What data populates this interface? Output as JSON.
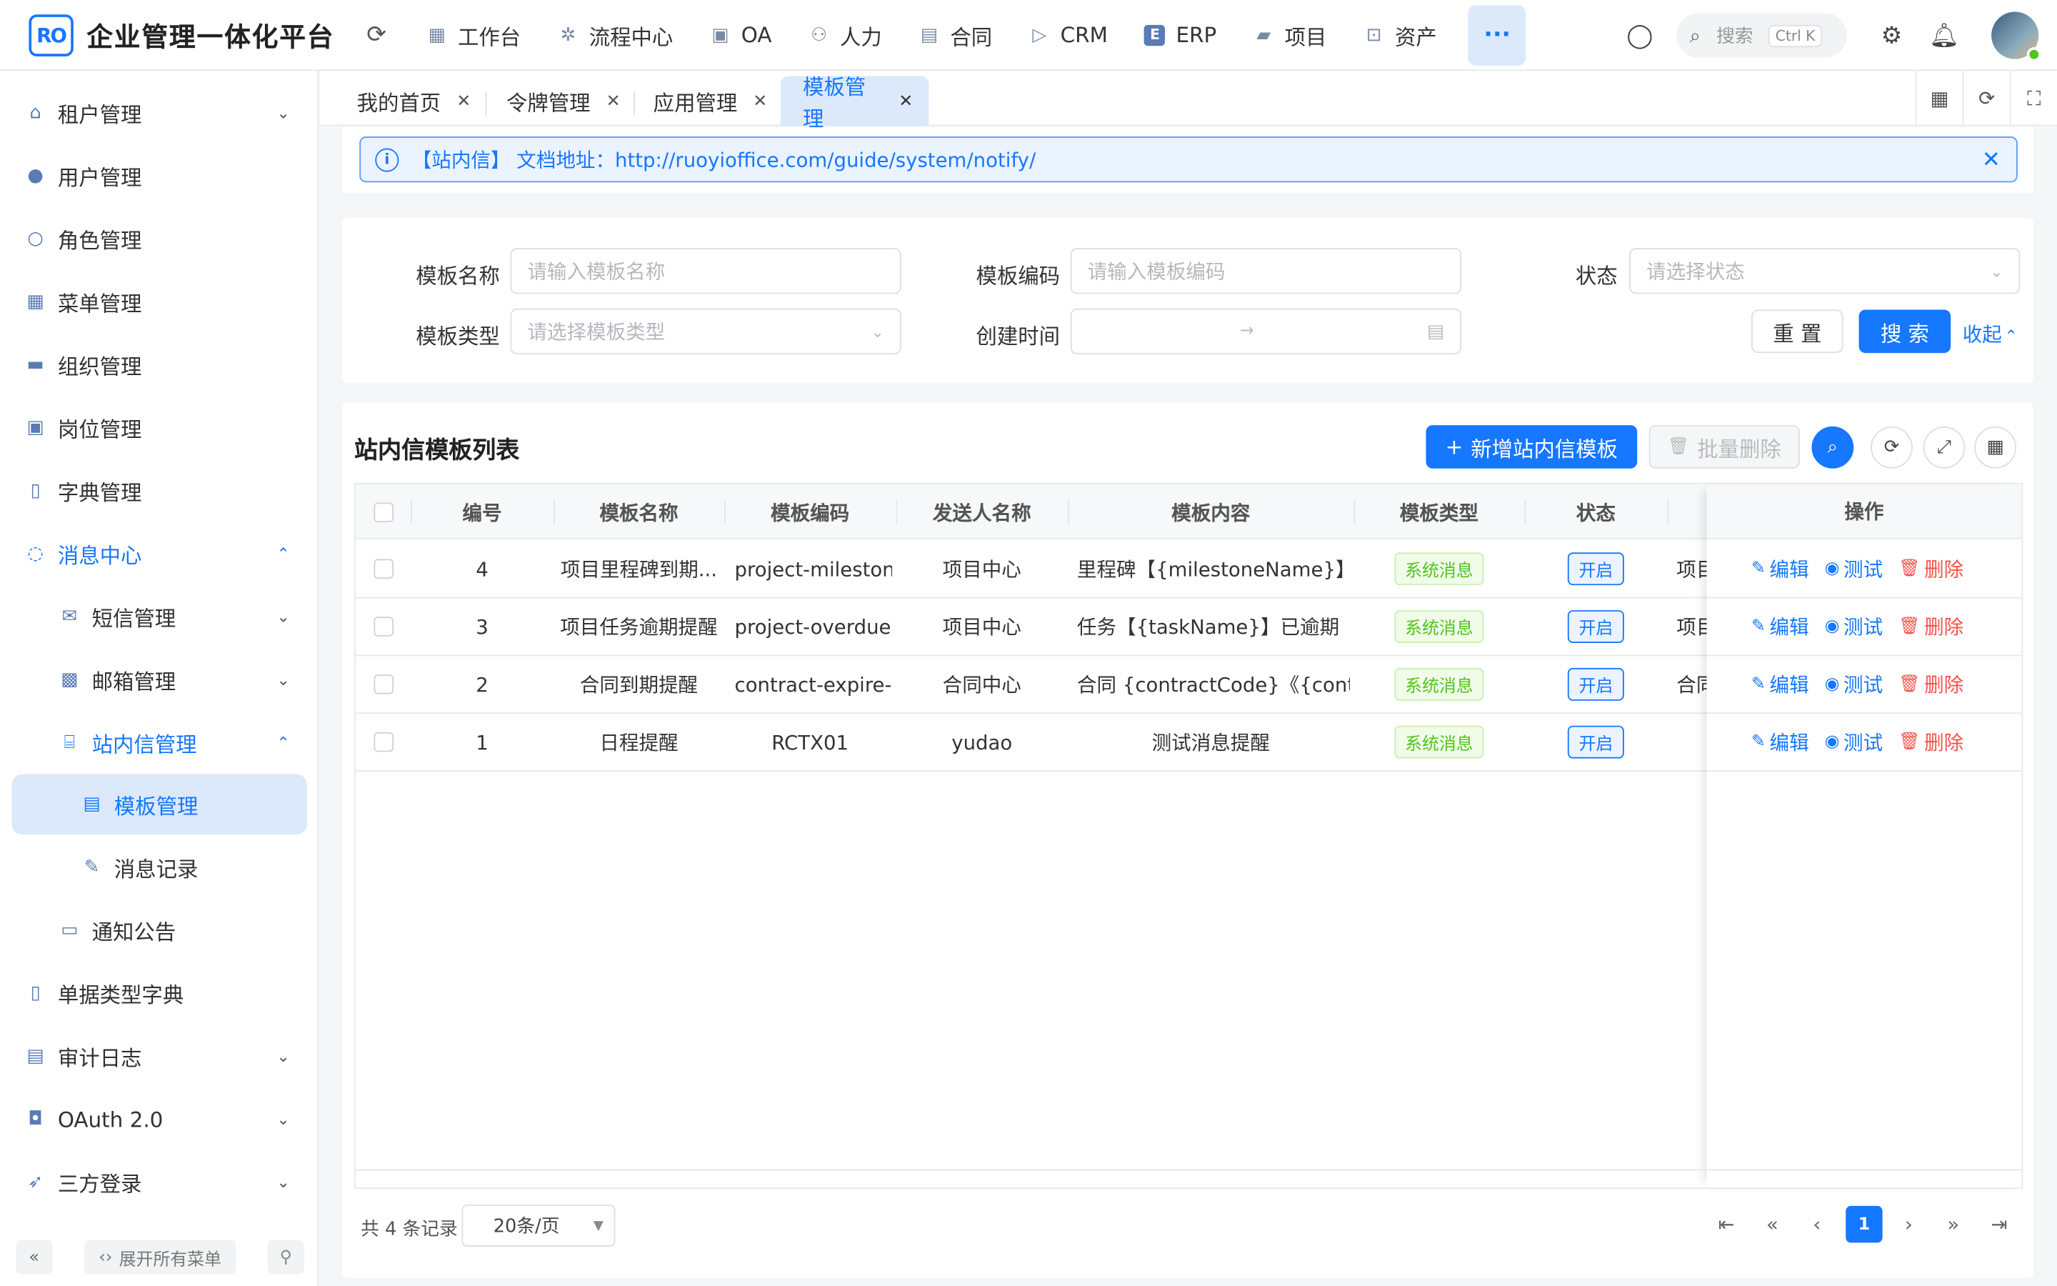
{
  "header": {
    "logo_mark": "RO",
    "title": "企业管理一体化平台",
    "nav": [
      {
        "label": "工作台",
        "icon": "grid-icon"
      },
      {
        "label": "流程中心",
        "icon": "atom-icon"
      },
      {
        "label": "OA",
        "icon": "monitor-icon"
      },
      {
        "label": "人力",
        "icon": "users-icon"
      },
      {
        "label": "合同",
        "icon": "document-icon"
      },
      {
        "label": "CRM",
        "icon": "send-icon"
      },
      {
        "label": "ERP",
        "icon": "erp-icon"
      },
      {
        "label": "项目",
        "icon": "briefcase-icon"
      },
      {
        "label": "资产",
        "icon": "box-icon"
      }
    ],
    "more": "···",
    "search_placeholder": "搜索",
    "search_shortcut": "Ctrl K"
  },
  "sidebar": {
    "items": [
      {
        "label": "租户管理",
        "icon": "home-icon",
        "chevron": "down"
      },
      {
        "label": "用户管理",
        "icon": "user-icon"
      },
      {
        "label": "角色管理",
        "icon": "role-icon"
      },
      {
        "label": "菜单管理",
        "icon": "menu-icon"
      },
      {
        "label": "组织管理",
        "icon": "org-icon"
      },
      {
        "label": "岗位管理",
        "icon": "post-icon"
      },
      {
        "label": "字典管理",
        "icon": "book-icon"
      },
      {
        "label": "消息中心",
        "icon": "chat-icon",
        "chevron": "up"
      },
      {
        "label": "短信管理",
        "icon": "mail-icon",
        "chevron": "down"
      },
      {
        "label": "邮箱管理",
        "icon": "mailbox-icon",
        "chevron": "down"
      },
      {
        "label": "站内信管理",
        "icon": "inbox-icon",
        "chevron": "up"
      },
      {
        "label": "模板管理",
        "icon": "archive-icon"
      },
      {
        "label": "消息记录",
        "icon": "edit-icon"
      },
      {
        "label": "通知公告",
        "icon": "notice-icon"
      },
      {
        "label": "单据类型字典",
        "icon": "file-icon"
      },
      {
        "label": "审计日志",
        "icon": "log-icon",
        "chevron": "down"
      },
      {
        "label": "OAuth 2.0",
        "icon": "oauth-icon",
        "chevron": "down"
      },
      {
        "label": "三方登录",
        "icon": "rocket-icon",
        "chevron": "down"
      }
    ],
    "expand_all": "展开所有菜单"
  },
  "tabs": [
    {
      "label": "我的首页"
    },
    {
      "label": "令牌管理"
    },
    {
      "label": "应用管理"
    },
    {
      "label": "模板管理"
    }
  ],
  "alert": {
    "text": "【站内信】 文档地址：http://ruoyioffice.com/guide/system/notify/"
  },
  "form": {
    "name_label": "模板名称",
    "name_placeholder": "请输入模板名称",
    "code_label": "模板编码",
    "code_placeholder": "请输入模板编码",
    "status_label": "状态",
    "status_placeholder": "请选择状态",
    "type_label": "模板类型",
    "type_placeholder": "请选择模板类型",
    "created_label": "创建时间",
    "range_sep": "→",
    "reset": "重 置",
    "search": "搜 索",
    "collapse": "收起"
  },
  "table": {
    "title": "站内信模板列表",
    "add_button": "新增站内信模板",
    "batch_delete": "批量删除",
    "columns": [
      "编号",
      "模板名称",
      "模板编码",
      "发送人名称",
      "模板内容",
      "模板类型",
      "状态",
      "操作"
    ],
    "rows": [
      {
        "id": "4",
        "name": "项目里程碑到期...",
        "code": "project-mileston...",
        "sender": "项目中心",
        "content": "里程碑【{milestoneName}】将...",
        "type": "系统消息",
        "status": "开启",
        "extra": "项目"
      },
      {
        "id": "3",
        "name": "项目任务逾期提醒",
        "code": "project-overdue...",
        "sender": "项目中心",
        "content": "任务【{taskName}】已逾期（...",
        "type": "系统消息",
        "status": "开启",
        "extra": "项目"
      },
      {
        "id": "2",
        "name": "合同到期提醒",
        "code": "contract-expire-...",
        "sender": "合同中心",
        "content": "合同 {contractCode}《{contrac...",
        "type": "系统消息",
        "status": "开启",
        "extra": "合同"
      },
      {
        "id": "1",
        "name": "日程提醒",
        "code": "RCTX01",
        "sender": "yudao",
        "content": "测试消息提醒",
        "type": "系统消息",
        "status": "开启",
        "extra": ""
      }
    ],
    "ops": {
      "edit": "编辑",
      "test": "测试",
      "delete": "删除"
    }
  },
  "pager": {
    "total": "共 4 条记录",
    "size": "20条/页",
    "current": "1"
  }
}
